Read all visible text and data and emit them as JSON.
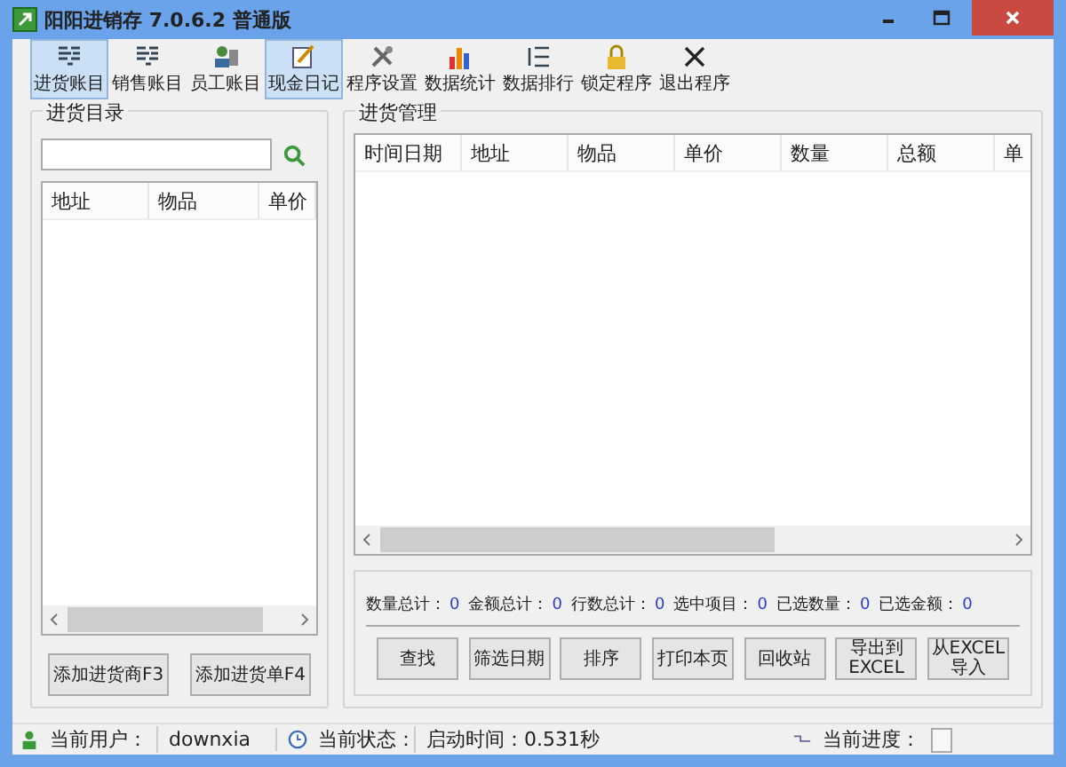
{
  "window": {
    "title": "阳阳进销存 7.0.6.2 普通版"
  },
  "toolbar": [
    {
      "label": "进货账目",
      "kind": "list",
      "selected": true
    },
    {
      "label": "销售账目",
      "kind": "list",
      "selected": false
    },
    {
      "label": "员工账目",
      "kind": "people",
      "selected": false
    },
    {
      "label": "现金日记",
      "kind": "note",
      "selected": true
    },
    {
      "label": "程序设置",
      "kind": "tools",
      "selected": false
    },
    {
      "label": "数据统计",
      "kind": "chart",
      "selected": false
    },
    {
      "label": "数据排行",
      "kind": "rank",
      "selected": false
    },
    {
      "label": "锁定程序",
      "kind": "lock",
      "selected": false
    },
    {
      "label": "退出程序",
      "kind": "close",
      "selected": false
    }
  ],
  "left_panel": {
    "title": "进货目录",
    "columns": [
      "地址",
      "物品",
      "单价"
    ],
    "buttons": [
      "添加进货商F3",
      "添加进货单F4"
    ]
  },
  "right_panel": {
    "title": "进货管理",
    "columns": [
      "时间日期",
      "地址",
      "物品",
      "单价",
      "数量",
      "总额",
      "单"
    ],
    "totals": [
      {
        "label": "数量总计：",
        "value": "0"
      },
      {
        "label": "金额总计：",
        "value": "0"
      },
      {
        "label": "行数总计：",
        "value": "0"
      },
      {
        "label": "选中项目：",
        "value": "0"
      },
      {
        "label": "已选数量：",
        "value": "0"
      },
      {
        "label": "已选金额：",
        "value": "0"
      }
    ],
    "buttons": [
      {
        "lines": [
          "查找"
        ]
      },
      {
        "lines": [
          "筛选日期"
        ]
      },
      {
        "lines": [
          "排序"
        ]
      },
      {
        "lines": [
          "打印本页"
        ]
      },
      {
        "lines": [
          "回收站"
        ]
      },
      {
        "lines": [
          "导出到",
          "EXCEL"
        ]
      },
      {
        "lines": [
          "从EXCEL",
          "导入"
        ]
      }
    ]
  },
  "status_bar": {
    "user_label": "当前用户：",
    "user": "downxia",
    "state_label": "当前状态：",
    "state": "启动时间：0.531秒",
    "progress_label": "当前进度："
  }
}
